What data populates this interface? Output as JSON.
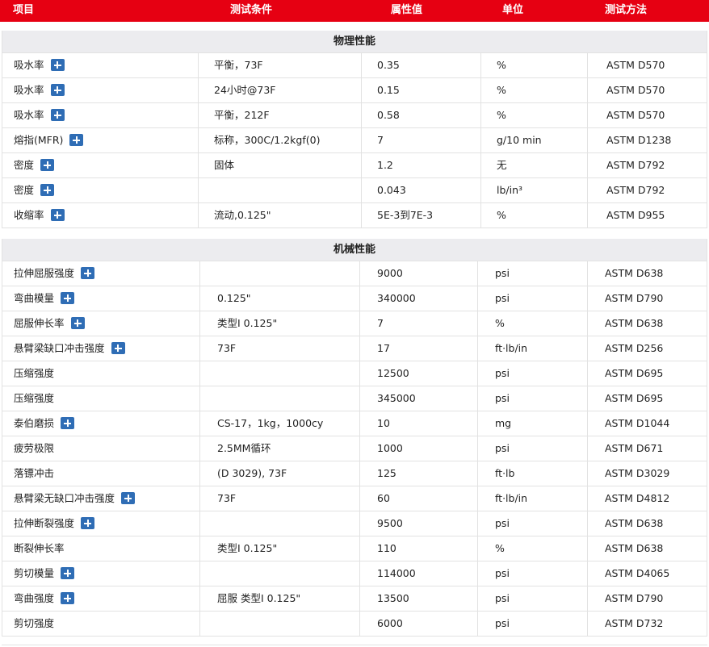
{
  "header": {
    "item": "项目",
    "condition": "测试条件",
    "value": "属性值",
    "unit": "单位",
    "method": "测试方法"
  },
  "sections": [
    {
      "title": "物理性能",
      "rows": [
        {
          "item": "吸水率",
          "plus": true,
          "condition": "平衡，73F",
          "value": "0.35",
          "unit": "%",
          "method": "ASTM D570"
        },
        {
          "item": "吸水率",
          "plus": true,
          "condition": "24小时@73F",
          "value": "0.15",
          "unit": "%",
          "method": "ASTM D570"
        },
        {
          "item": "吸水率",
          "plus": true,
          "condition": "平衡，212F",
          "value": "0.58",
          "unit": "%",
          "method": "ASTM D570"
        },
        {
          "item": "熔指(MFR)",
          "plus": true,
          "condition": "标称，300C/1.2kgf(0)",
          "value": "7",
          "unit": "g/10 min",
          "method": "ASTM D1238"
        },
        {
          "item": "密度",
          "plus": true,
          "condition": "固体",
          "value": "1.2",
          "unit": "无",
          "method": "ASTM D792"
        },
        {
          "item": "密度",
          "plus": true,
          "condition": "",
          "value": "0.043",
          "unit": "lb/in³",
          "method": "ASTM D792"
        },
        {
          "item": "收缩率",
          "plus": true,
          "condition": "流动,0.125\"",
          "value": "5E-3到7E-3",
          "unit": "%",
          "method": "ASTM D955"
        }
      ]
    },
    {
      "title": "机械性能",
      "rows": [
        {
          "item": "拉伸屈服强度",
          "plus": true,
          "condition": "",
          "value": "9000",
          "unit": "psi",
          "method": "ASTM D638"
        },
        {
          "item": "弯曲模量",
          "plus": true,
          "condition": "0.125\"",
          "value": "340000",
          "unit": "psi",
          "method": "ASTM D790"
        },
        {
          "item": "屈服伸长率",
          "plus": true,
          "condition": "类型I 0.125\"",
          "value": "7",
          "unit": "%",
          "method": "ASTM D638"
        },
        {
          "item": "悬臂梁缺口冲击强度",
          "plus": true,
          "condition": "73F",
          "value": "17",
          "unit": "ft·lb/in",
          "method": "ASTM D256"
        },
        {
          "item": "压缩强度",
          "plus": false,
          "condition": "",
          "value": "12500",
          "unit": "psi",
          "method": "ASTM D695"
        },
        {
          "item": "压缩强度",
          "plus": false,
          "condition": "",
          "value": "345000",
          "unit": "psi",
          "method": "ASTM D695"
        },
        {
          "item": "泰伯磨损",
          "plus": true,
          "condition": "CS-17，1kg，1000cy",
          "value": "10",
          "unit": "mg",
          "method": "ASTM D1044"
        },
        {
          "item": "疲劳极限",
          "plus": false,
          "condition": "2.5MM循环",
          "value": "1000",
          "unit": "psi",
          "method": "ASTM D671"
        },
        {
          "item": "落镖冲击",
          "plus": false,
          "condition": "(D 3029), 73F",
          "value": "125",
          "unit": "ft·lb",
          "method": "ASTM D3029"
        },
        {
          "item": "悬臂梁无缺口冲击强度",
          "plus": true,
          "condition": "73F",
          "value": "60",
          "unit": "ft·lb/in",
          "method": "ASTM D4812"
        },
        {
          "item": "拉伸断裂强度",
          "plus": true,
          "condition": "",
          "value": "9500",
          "unit": "psi",
          "method": "ASTM D638"
        },
        {
          "item": "断裂伸长率",
          "plus": false,
          "condition": "类型I 0.125\"",
          "value": "110",
          "unit": "%",
          "method": "ASTM D638"
        },
        {
          "item": "剪切模量",
          "plus": true,
          "condition": "",
          "value": "114000",
          "unit": "psi",
          "method": "ASTM D4065"
        },
        {
          "item": "弯曲强度",
          "plus": true,
          "condition": "屈服 类型I 0.125\"",
          "value": "13500",
          "unit": "psi",
          "method": "ASTM D790"
        },
        {
          "item": "剪切强度",
          "plus": false,
          "condition": "",
          "value": "6000",
          "unit": "psi",
          "method": "ASTM D732"
        }
      ]
    }
  ]
}
